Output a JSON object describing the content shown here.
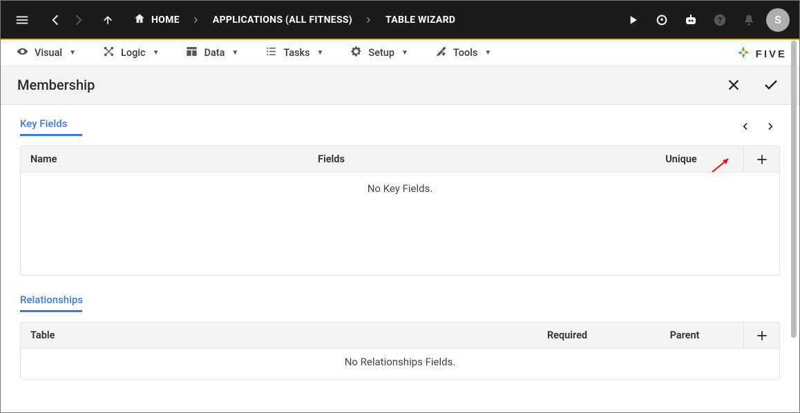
{
  "topbar": {
    "avatar": "S",
    "breadcrumbs": [
      {
        "key": "home",
        "label": "HOME",
        "icon": "home"
      },
      {
        "key": "apps",
        "label": "APPLICATIONS (ALL FITNESS)"
      },
      {
        "key": "tw",
        "label": "TABLE WIZARD"
      }
    ]
  },
  "menubar": {
    "items": [
      {
        "key": "visual",
        "label": "Visual",
        "icon": "eye"
      },
      {
        "key": "logic",
        "label": "Logic",
        "icon": "logic"
      },
      {
        "key": "data",
        "label": "Data",
        "icon": "grid"
      },
      {
        "key": "tasks",
        "label": "Tasks",
        "icon": "list"
      },
      {
        "key": "setup",
        "label": "Setup",
        "icon": "gear"
      },
      {
        "key": "tools",
        "label": "Tools",
        "icon": "tools"
      }
    ],
    "brand": "FIVE"
  },
  "titlebar": {
    "title": "Membership"
  },
  "sections": {
    "key_fields": {
      "title": "Key Fields",
      "columns": {
        "name": "Name",
        "fields": "Fields",
        "unique": "Unique"
      },
      "empty": "No Key Fields."
    },
    "relationships": {
      "title": "Relationships",
      "columns": {
        "table": "Table",
        "required": "Required",
        "parent": "Parent"
      },
      "empty": "No Relationships Fields."
    }
  },
  "colors": {
    "accent": "#f5b100",
    "link": "#3d7bd9"
  }
}
